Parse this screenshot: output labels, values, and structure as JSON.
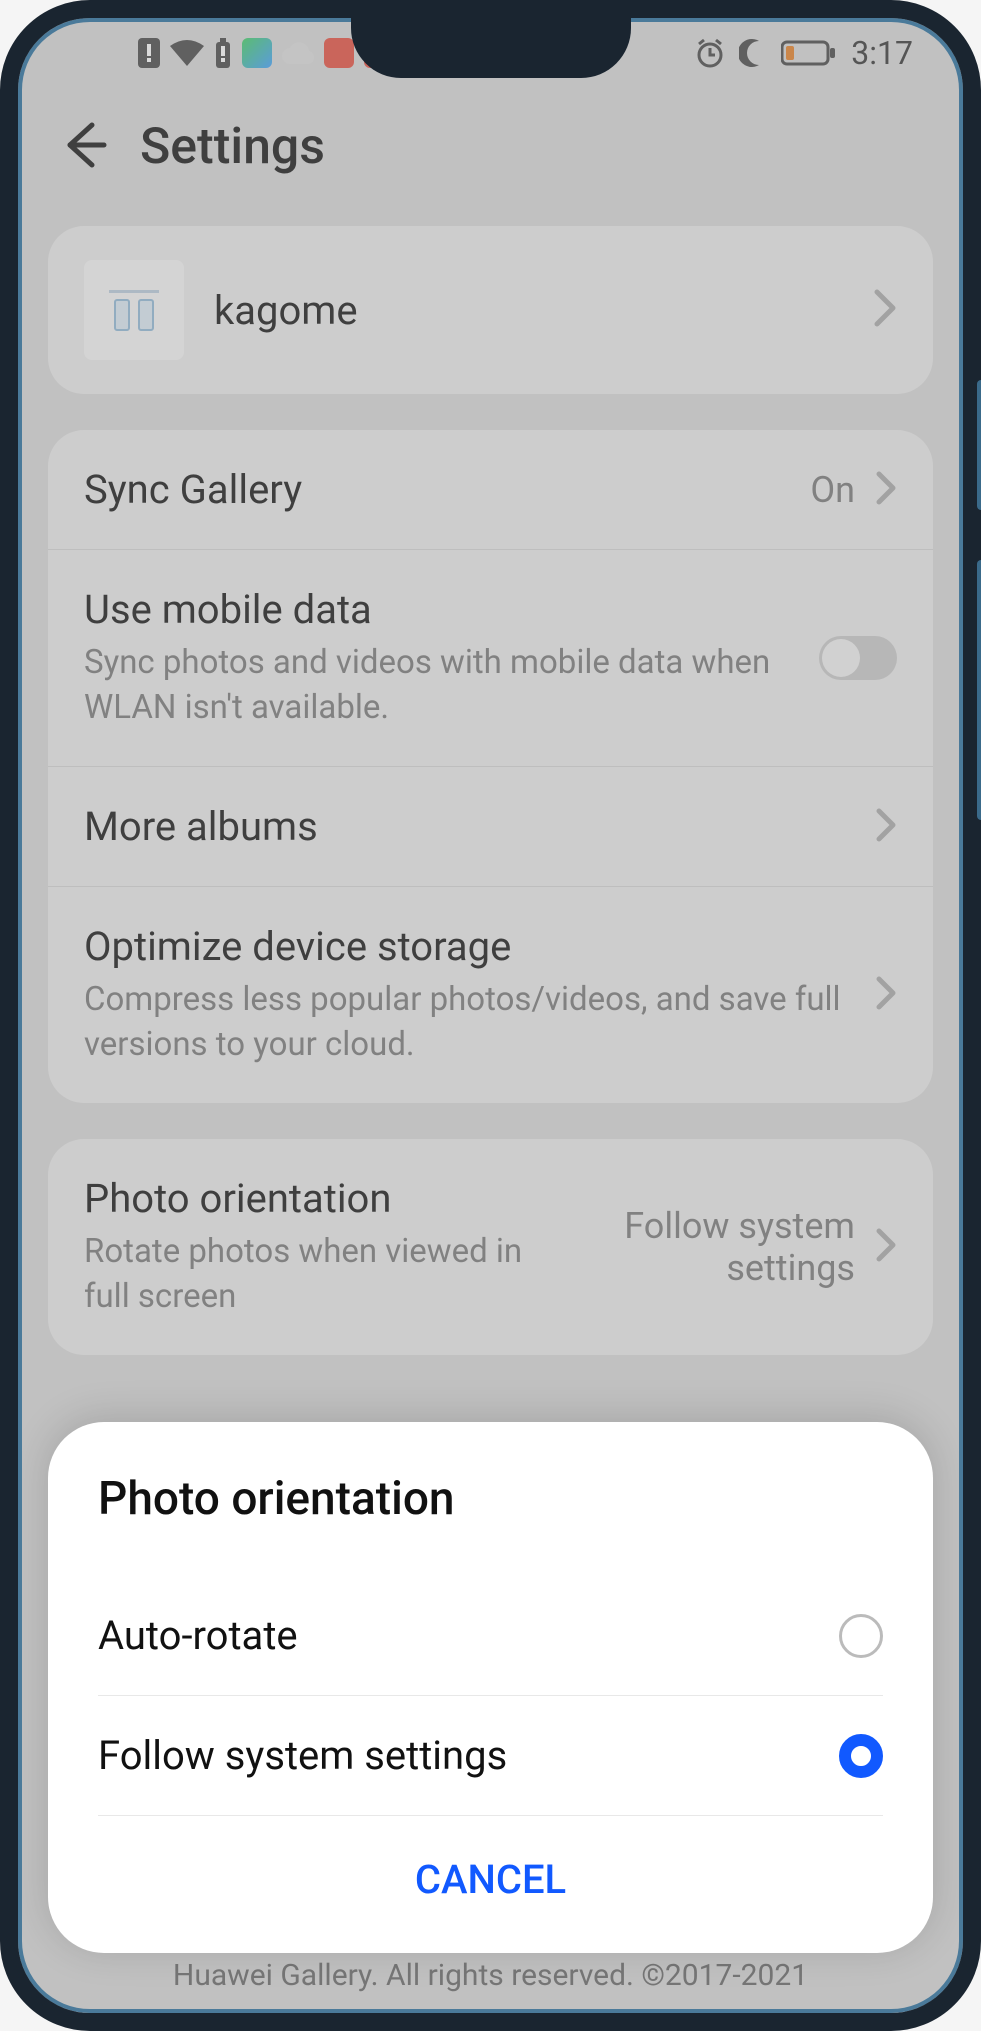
{
  "status": {
    "time": "3:17",
    "icons_right": [
      "alarm-icon",
      "moon-icon",
      "battery-low-icon"
    ]
  },
  "header": {
    "title": "Settings"
  },
  "profile": {
    "name": "kagome"
  },
  "settings": {
    "sync": {
      "title": "Sync Gallery",
      "value": "On"
    },
    "mobile_data": {
      "title": "Use mobile data",
      "sub": "Sync photos and videos with mobile data when WLAN isn't available."
    },
    "more_albums": {
      "title": "More albums"
    },
    "optimize": {
      "title": "Optimize device storage",
      "sub": "Compress less popular photos/videos, and save full versions to your cloud."
    },
    "orientation": {
      "title": "Photo orientation",
      "sub": "Rotate photos when viewed in full screen",
      "value": "Follow system settings"
    }
  },
  "sheet": {
    "title": "Photo orientation",
    "options": [
      {
        "label": "Auto-rotate",
        "selected": false
      },
      {
        "label": "Follow system settings",
        "selected": true
      }
    ],
    "cancel": "CANCEL"
  },
  "footer": "Huawei Gallery. All rights reserved. ©2017-2021"
}
